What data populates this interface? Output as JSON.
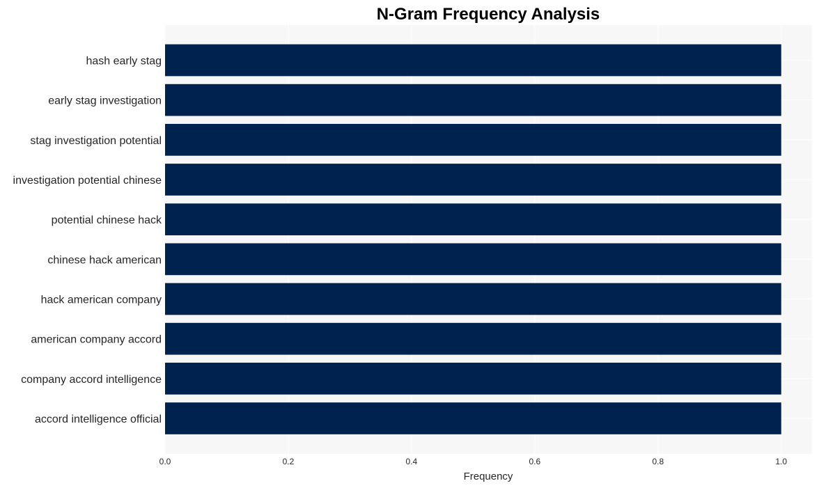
{
  "chart_data": {
    "type": "bar",
    "orientation": "horizontal",
    "title": "N-Gram Frequency Analysis",
    "xlabel": "Frequency",
    "ylabel": "",
    "categories": [
      "hash early stag",
      "early stag investigation",
      "stag investigation potential",
      "investigation potential chinese",
      "potential chinese hack",
      "chinese hack american",
      "hack american company",
      "american company accord",
      "company accord intelligence",
      "accord intelligence official"
    ],
    "values": [
      1,
      1,
      1,
      1,
      1,
      1,
      1,
      1,
      1,
      1
    ],
    "xlim": [
      0,
      1.05
    ],
    "xticks": [
      0.0,
      0.2,
      0.4,
      0.6,
      0.8,
      1.0
    ],
    "xtick_labels": [
      "0.0",
      "0.2",
      "0.4",
      "0.6",
      "0.8",
      "1.0"
    ],
    "grid": true,
    "legend": "none",
    "colors": {
      "bar": "#00224e",
      "plot_background": "#f7f7f7",
      "grid": "#ffffff",
      "text": "#262626"
    }
  }
}
